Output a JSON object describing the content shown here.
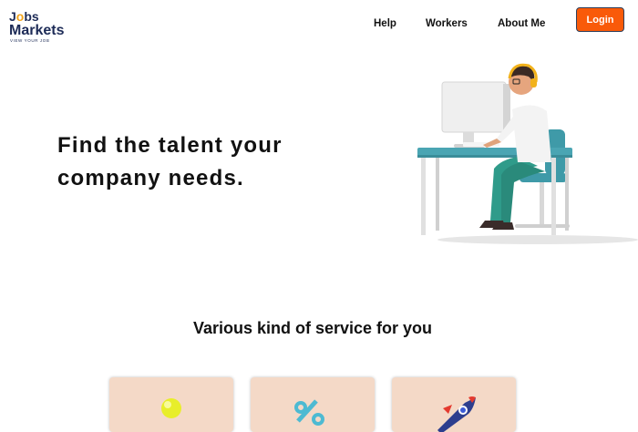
{
  "header": {
    "logo": {
      "line1": "Jobs",
      "line2": "Markets",
      "tagline": "VIEW YOUR JOB"
    },
    "nav": [
      {
        "label": "Help"
      },
      {
        "label": "Workers"
      },
      {
        "label": "About Me"
      }
    ],
    "login_label": "Login"
  },
  "hero": {
    "title": "Find the talent your company needs."
  },
  "services": {
    "heading": "Various kind of service for you",
    "cards": [
      {
        "icon": "lightbulb-icon"
      },
      {
        "icon": "percent-icon"
      },
      {
        "icon": "rocket-icon"
      }
    ]
  },
  "colors": {
    "accent": "#f95a09",
    "brand_navy": "#1d2b57",
    "card_bg": "#f4d9c7"
  }
}
